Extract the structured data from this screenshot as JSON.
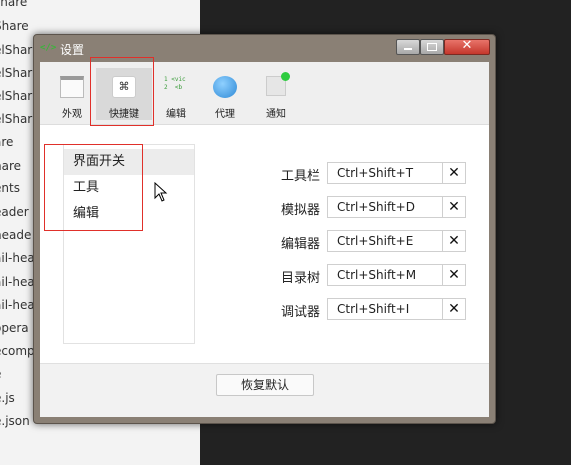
{
  "background": {
    "file_rows": [
      "share",
      "Share",
      "elShar",
      "elShar",
      "elShar",
      "elShar",
      "are",
      "hare",
      "ents",
      "eader",
      "heade",
      "ail-hea",
      "ail-hea",
      "ail-hea",
      "opera",
      "ecompt",
      "e",
      "e.js",
      "e.json"
    ]
  },
  "window": {
    "app_icon": "</>",
    "title": "设置",
    "close_glyph": "✕"
  },
  "toolbar": {
    "items": [
      {
        "label": "外观",
        "icon": "appearance-icon"
      },
      {
        "label": "快捷键",
        "icon": "command-key-icon",
        "glyph": "⌘",
        "selected": true
      },
      {
        "label": "编辑",
        "icon": "code-editor-icon",
        "glyph": "1 <vic\n2  <b"
      },
      {
        "label": "代理",
        "icon": "globe-icon"
      },
      {
        "label": "通知",
        "icon": "notification-icon"
      }
    ]
  },
  "categories": [
    {
      "label": "界面开关",
      "selected": true
    },
    {
      "label": "工具",
      "selected": false
    },
    {
      "label": "编辑",
      "selected": false
    }
  ],
  "shortcuts": [
    {
      "name": "工具栏",
      "value": "Ctrl+Shift+T"
    },
    {
      "name": "模拟器",
      "value": "Ctrl+Shift+D"
    },
    {
      "name": "编辑器",
      "value": "Ctrl+Shift+E"
    },
    {
      "name": "目录树",
      "value": "Ctrl+Shift+M"
    },
    {
      "name": "调试器",
      "value": "Ctrl+Shift+I"
    }
  ],
  "clear_glyph": "✕",
  "footer": {
    "restore_label": "恢复默认"
  },
  "colors": {
    "annotation": "#e0302a",
    "selected_tool_bg": "#d9d9d9",
    "notify_dot": "#2ecc40"
  }
}
